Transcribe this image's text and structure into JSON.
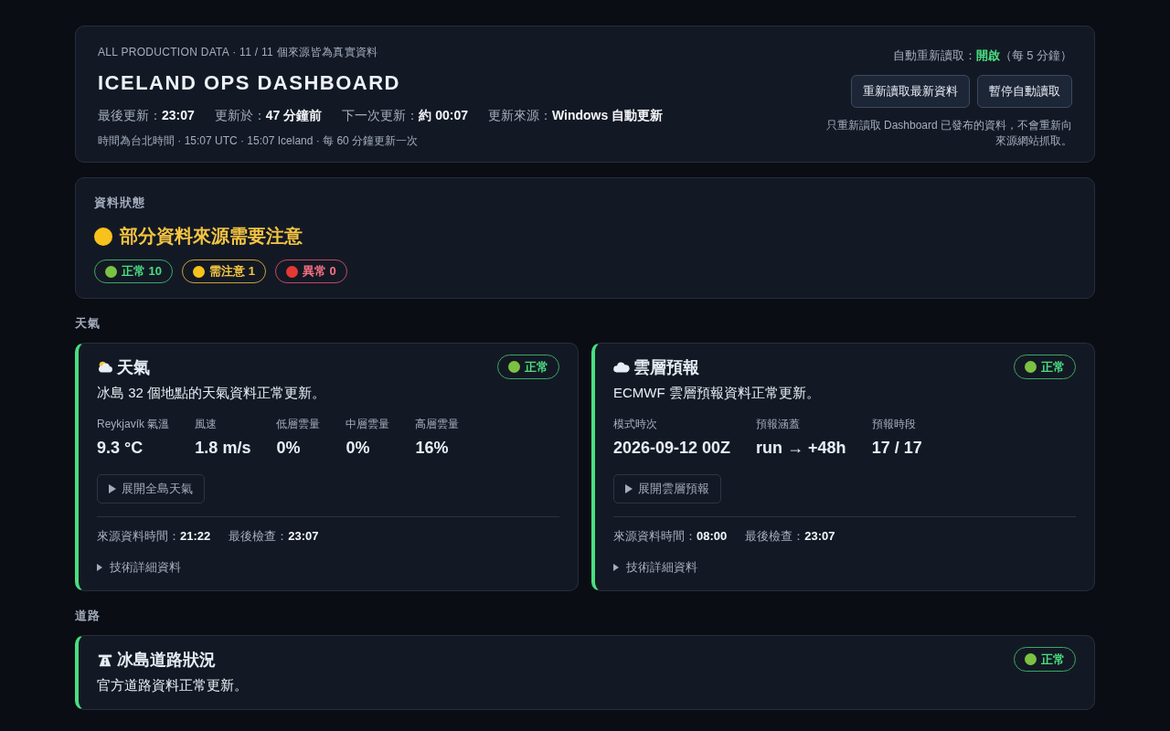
{
  "header": {
    "eyebrow": "ALL PRODUCTION DATA · 11 / 11 個來源皆為真實資料",
    "title": "ICELAND OPS DASHBOARD",
    "meta": [
      {
        "label": "最後更新：",
        "value": "23:07"
      },
      {
        "label": "更新於：",
        "value": "47 分鐘前"
      },
      {
        "label": "下一次更新：",
        "value": "約 00:07"
      },
      {
        "label": "更新來源：",
        "value": "Windows 自動更新"
      }
    ],
    "timezone_note": "時間為台北時間 · 15:07 UTC · 15:07 Iceland · 每 60 分鐘更新一次",
    "auto_refresh": {
      "label": "自動重新讀取：",
      "state": "開啟",
      "on": true,
      "interval": "（每 5 分鐘）"
    },
    "buttons": [
      "重新讀取最新資料",
      "暫停自動讀取"
    ],
    "note": "只重新讀取 Dashboard 已發布的資料，不會重新向來源網站抓取。"
  },
  "status": {
    "heading": "資料狀態",
    "summary": "部分資料來源需要注意",
    "kind": "warning",
    "counts": [
      {
        "label": "正常 10",
        "kind": "ok"
      },
      {
        "label": "需注意 1",
        "kind": "warning"
      },
      {
        "label": "異常 0",
        "kind": "error"
      }
    ]
  },
  "sections": [
    {
      "heading": "天氣",
      "cards": [
        {
          "title": "天氣",
          "status": {
            "label": "正常",
            "kind": "ok"
          },
          "description": "冰島 32 個地點的天氣資料正常更新。",
          "metrics": [
            {
              "label": "Reykjavík 氣溫",
              "value": "9.3 °C"
            },
            {
              "label": "風速",
              "value": "1.8 m/s"
            },
            {
              "label": "低層雲量",
              "value": "0%"
            },
            {
              "label": "中層雲量",
              "value": "0%"
            },
            {
              "label": "高層雲量",
              "value": "16%"
            }
          ],
          "expand_button": "展開全島天氣",
          "footer": [
            {
              "label": "來源資料時間：",
              "value": "21:22"
            },
            {
              "label": "最後檢查：",
              "value": "23:07"
            }
          ],
          "details": "技術詳細資料"
        },
        {
          "title": "雲層預報",
          "status": {
            "label": "正常",
            "kind": "ok"
          },
          "description": "ECMWF 雲層預報資料正常更新。",
          "metrics": [
            {
              "label": "模式時次",
              "value": "2026-09-12 00Z"
            },
            {
              "label": "預報涵蓋",
              "value": "run → +48h"
            },
            {
              "label": "預報時段",
              "value": "17 / 17"
            }
          ],
          "expand_button": "展開雲層預報",
          "footer": [
            {
              "label": "來源資料時間：",
              "value": "08:00"
            },
            {
              "label": "最後檢查：",
              "value": "23:07"
            }
          ],
          "details": "技術詳細資料"
        }
      ]
    },
    {
      "heading": "道路",
      "cards": [
        {
          "title": "冰島道路狀況",
          "status": {
            "label": "正常",
            "kind": "ok"
          },
          "description": "官方道路資料正常更新。"
        }
      ]
    }
  ]
}
